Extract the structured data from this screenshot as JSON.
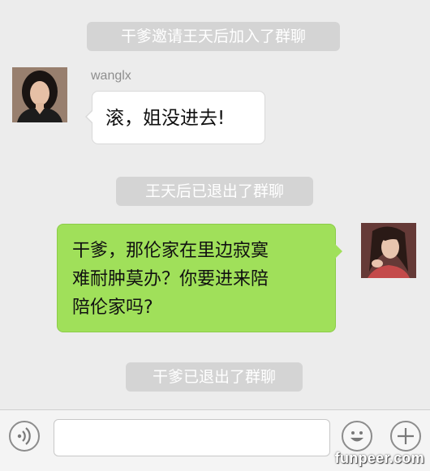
{
  "chat": {
    "system_messages": [
      "干爹邀请王天后加入了群聊",
      "王天后已退出了群聊",
      "干爹已退出了群聊"
    ],
    "incoming": {
      "sender": "wanglx",
      "text": "滚，姐没进去!"
    },
    "outgoing": {
      "lines": [
        "干爹，那伦家在里边寂寞",
        "难耐肿莫办？你要进来陪",
        "陪伦家吗?"
      ]
    }
  },
  "input_bar": {
    "text_value": "",
    "icons": [
      "voice-icon",
      "emoji-icon",
      "plus-icon"
    ]
  },
  "watermark": "funpeer.com",
  "colors": {
    "background": "#ececec",
    "outgoing_bubble": "#a0e05a",
    "system_pill": "#d4d4d4"
  }
}
